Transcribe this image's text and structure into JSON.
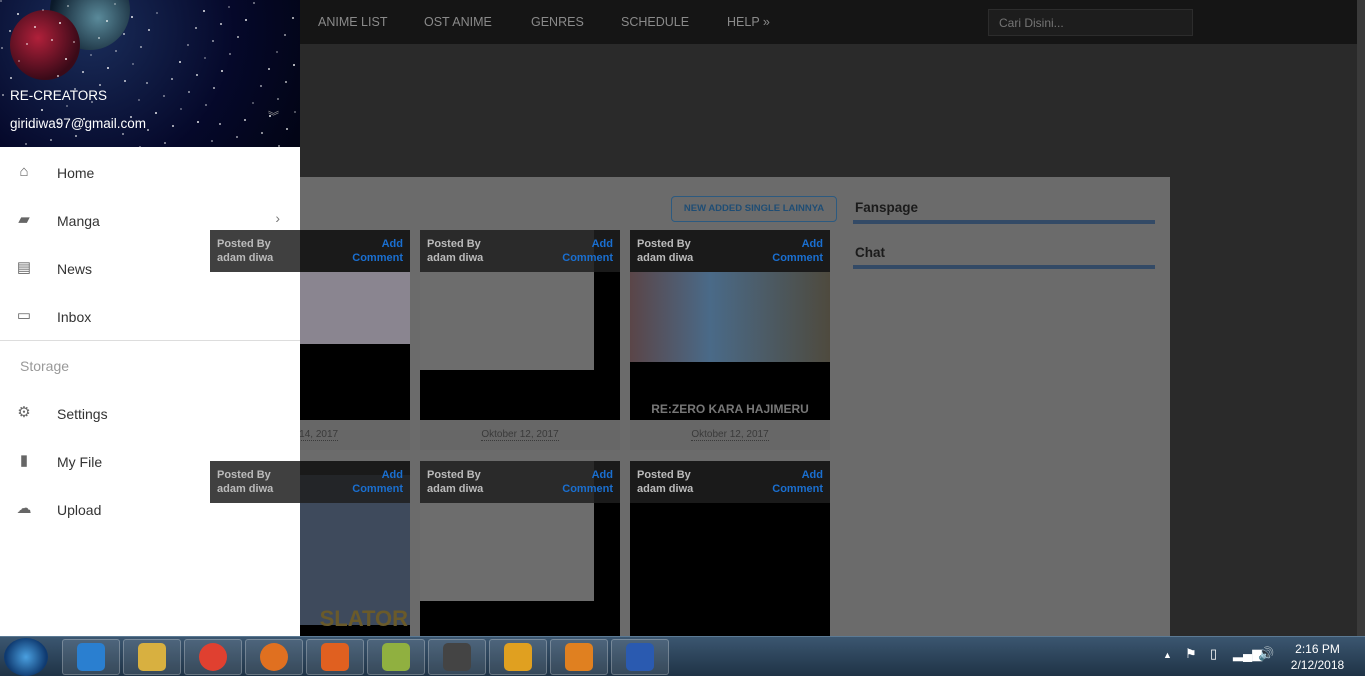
{
  "nav": {
    "items": [
      "ANIME LIST",
      "OST ANIME",
      "GENRES",
      "SCHEDULE",
      "HELP »"
    ],
    "search_placeholder": "Cari Disini..."
  },
  "main": {
    "new_button": "NEW ADDED SINGLE LAINNYA",
    "cards": [
      {
        "posted_by": "Posted By",
        "author": "adam diwa",
        "add": "Add",
        "comment": "Comment",
        "title": "",
        "date": "ber 14, 2017"
      },
      {
        "posted_by": "Posted By",
        "author": "adam diwa",
        "add": "Add",
        "comment": "Comment",
        "title": "",
        "date": "Oktober 12, 2017"
      },
      {
        "posted_by": "Posted By",
        "author": "adam diwa",
        "add": "Add",
        "comment": "Comment",
        "title": "RE:ZERO KARA HAJIMERU",
        "date": "Oktober 12, 2017"
      },
      {
        "posted_by": "Posted By",
        "author": "adam diwa",
        "add": "Add",
        "comment": "Comment",
        "title": "SLATOR"
      },
      {
        "posted_by": "Posted By",
        "author": "adam diwa",
        "add": "Add",
        "comment": "Comment",
        "title": ""
      },
      {
        "posted_by": "Posted By",
        "author": "adam diwa",
        "add": "Add",
        "comment": "Comment",
        "title": ""
      }
    ]
  },
  "sidebar_widgets": [
    "Fanspage",
    "Chat"
  ],
  "accent_color": "#334a66",
  "drawer": {
    "name": "RE-CREATORS",
    "email": "giridiwa97@gmail.com",
    "items": [
      {
        "label": "Home",
        "icon": "home-icon"
      },
      {
        "label": "Manga",
        "icon": "book-icon"
      },
      {
        "label": "News",
        "icon": "newspaper-icon"
      },
      {
        "label": "Inbox",
        "icon": "inbox-icon"
      }
    ],
    "section": "Storage",
    "storage_items": [
      {
        "label": "Settings",
        "icon": "gear-icon"
      },
      {
        "label": "My File",
        "icon": "file-icon"
      },
      {
        "label": "Upload",
        "icon": "cloud-upload-icon"
      }
    ]
  },
  "taskbar": {
    "apps": [
      "internet-explorer",
      "file-explorer",
      "chrome",
      "firefox",
      "media-player",
      "notepad",
      "sublime-text",
      "winamp",
      "music-player",
      "word"
    ],
    "time": "2:16 PM",
    "date": "2/12/2018"
  }
}
